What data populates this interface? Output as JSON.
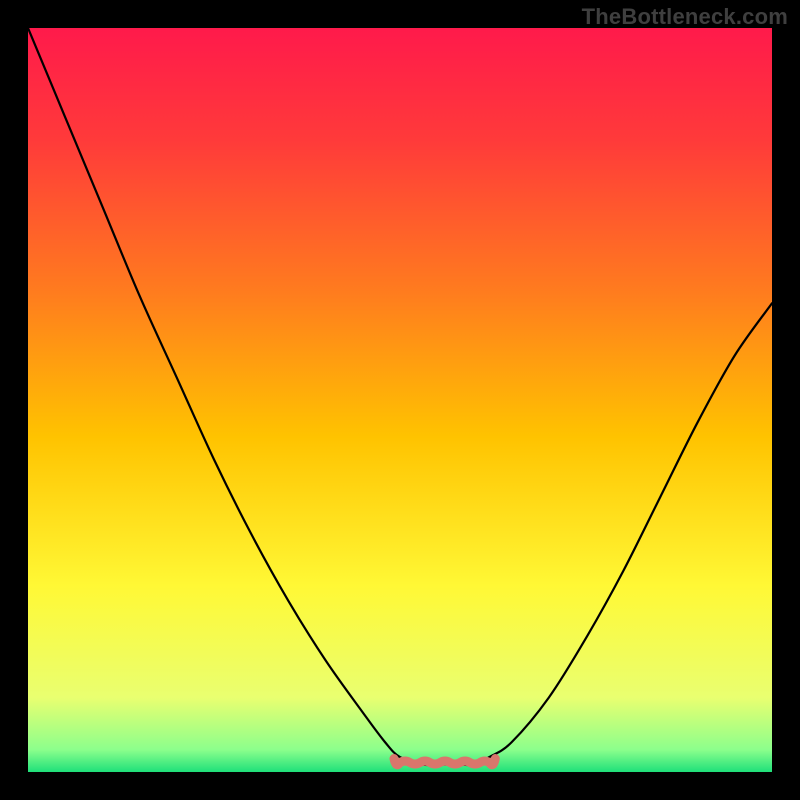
{
  "watermark": "TheBottleneck.com",
  "chart_data": {
    "type": "line",
    "title": "",
    "xlabel": "",
    "ylabel": "",
    "xlim": [
      0,
      100
    ],
    "ylim": [
      0,
      100
    ],
    "series": [
      {
        "name": "curve",
        "color": "#000000",
        "x": [
          0,
          5,
          10,
          15,
          20,
          25,
          30,
          35,
          40,
          45,
          48,
          50,
          53,
          55,
          58,
          60,
          62,
          65,
          70,
          75,
          80,
          85,
          90,
          95,
          100
        ],
        "y": [
          100,
          88,
          76,
          64,
          53,
          42,
          32,
          23,
          15,
          8,
          4,
          2,
          1,
          1,
          1,
          1,
          2,
          4,
          10,
          18,
          27,
          37,
          47,
          56,
          63
        ]
      },
      {
        "name": "optimal-range-marker",
        "color": "#d9766c",
        "x": [
          50,
          62
        ],
        "y": [
          1,
          1
        ]
      }
    ],
    "gradient_stops": [
      {
        "offset": 0.0,
        "color": "#ff1a4b"
      },
      {
        "offset": 0.15,
        "color": "#ff3a3a"
      },
      {
        "offset": 0.35,
        "color": "#ff7a1f"
      },
      {
        "offset": 0.55,
        "color": "#ffc300"
      },
      {
        "offset": 0.75,
        "color": "#fff835"
      },
      {
        "offset": 0.9,
        "color": "#e9ff70"
      },
      {
        "offset": 0.97,
        "color": "#8cff8c"
      },
      {
        "offset": 1.0,
        "color": "#1fe07a"
      }
    ]
  }
}
